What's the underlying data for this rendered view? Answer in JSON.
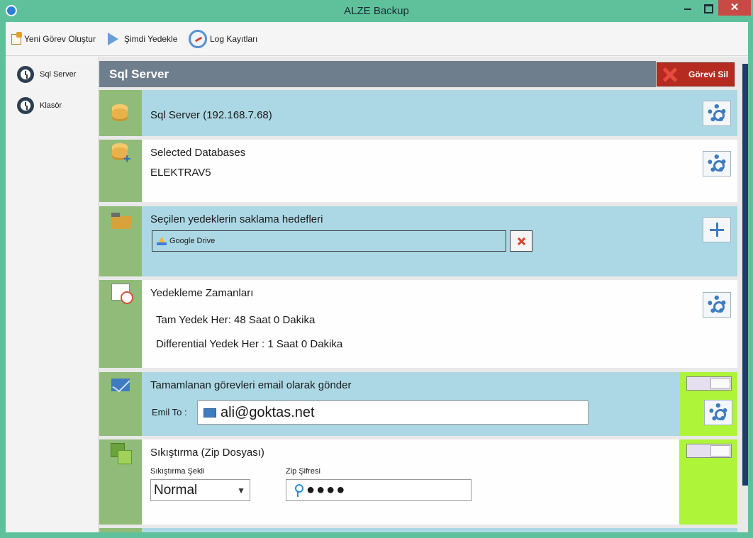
{
  "window": {
    "title": "ALZE Backup",
    "close_glyph": "✕"
  },
  "toolbar": {
    "new_task": "Yeni Görev Oluştur",
    "backup_now": "Şimdi Yedekle",
    "logs": "Log Kayıtları"
  },
  "sidebar": {
    "items": [
      {
        "label": "Sql Server"
      },
      {
        "label": "Klasör"
      }
    ]
  },
  "main": {
    "title": "Sql Server",
    "delete_button": "Görevi Sil"
  },
  "sections": {
    "server": {
      "title": "Sql Server (192.168.7.68)"
    },
    "databases": {
      "title": "Selected Databases",
      "value": "ELEKTRAV5"
    },
    "destinations": {
      "title": "Seçilen yedeklerin saklama hedefleri",
      "items": [
        "Google Drive"
      ]
    },
    "schedule": {
      "title": "Yedekleme Zamanları",
      "full": "Tam Yedek Her: 48 Saat 0 Dakika",
      "differential": "Differential Yedek Her : 1 Saat 0 Dakika"
    },
    "email": {
      "title": "Tamamlanan görevleri email olarak gönder",
      "label": "Emil To :",
      "value": "ali@goktas.net"
    },
    "zip": {
      "title": "Sıkıştırma (Zip Dosyası)",
      "method_label": "Sıkıştırma Şekli",
      "method_value": "Normal",
      "password_label": "Zip Şifresi",
      "password_value": "●●●●"
    }
  },
  "colors": {
    "titlebar": "#5fc19b",
    "header": "#6f7e8d",
    "delete": "#b52b1f",
    "stripe": "#91bb79",
    "blue_section": "#acd8e5",
    "green_toggle_panel": "#aef53a",
    "accent": "#3e7bc0"
  },
  "icons": {
    "app": "app-logo-icon",
    "new_task": "new-document-icon",
    "backup_now": "play-icon",
    "logs": "log-clock-icon",
    "sidebar": "history-clock-icon",
    "server": "database-icon",
    "databases": "database-add-icon",
    "destinations": "folder-icon",
    "schedule": "calendar-clock-icon",
    "email": "mail-icon",
    "zip": "zip-icon",
    "settings": "gear-icon",
    "add": "plus-icon",
    "remove": "close-icon",
    "drive": "google-drive-icon",
    "password": "key-icon"
  }
}
